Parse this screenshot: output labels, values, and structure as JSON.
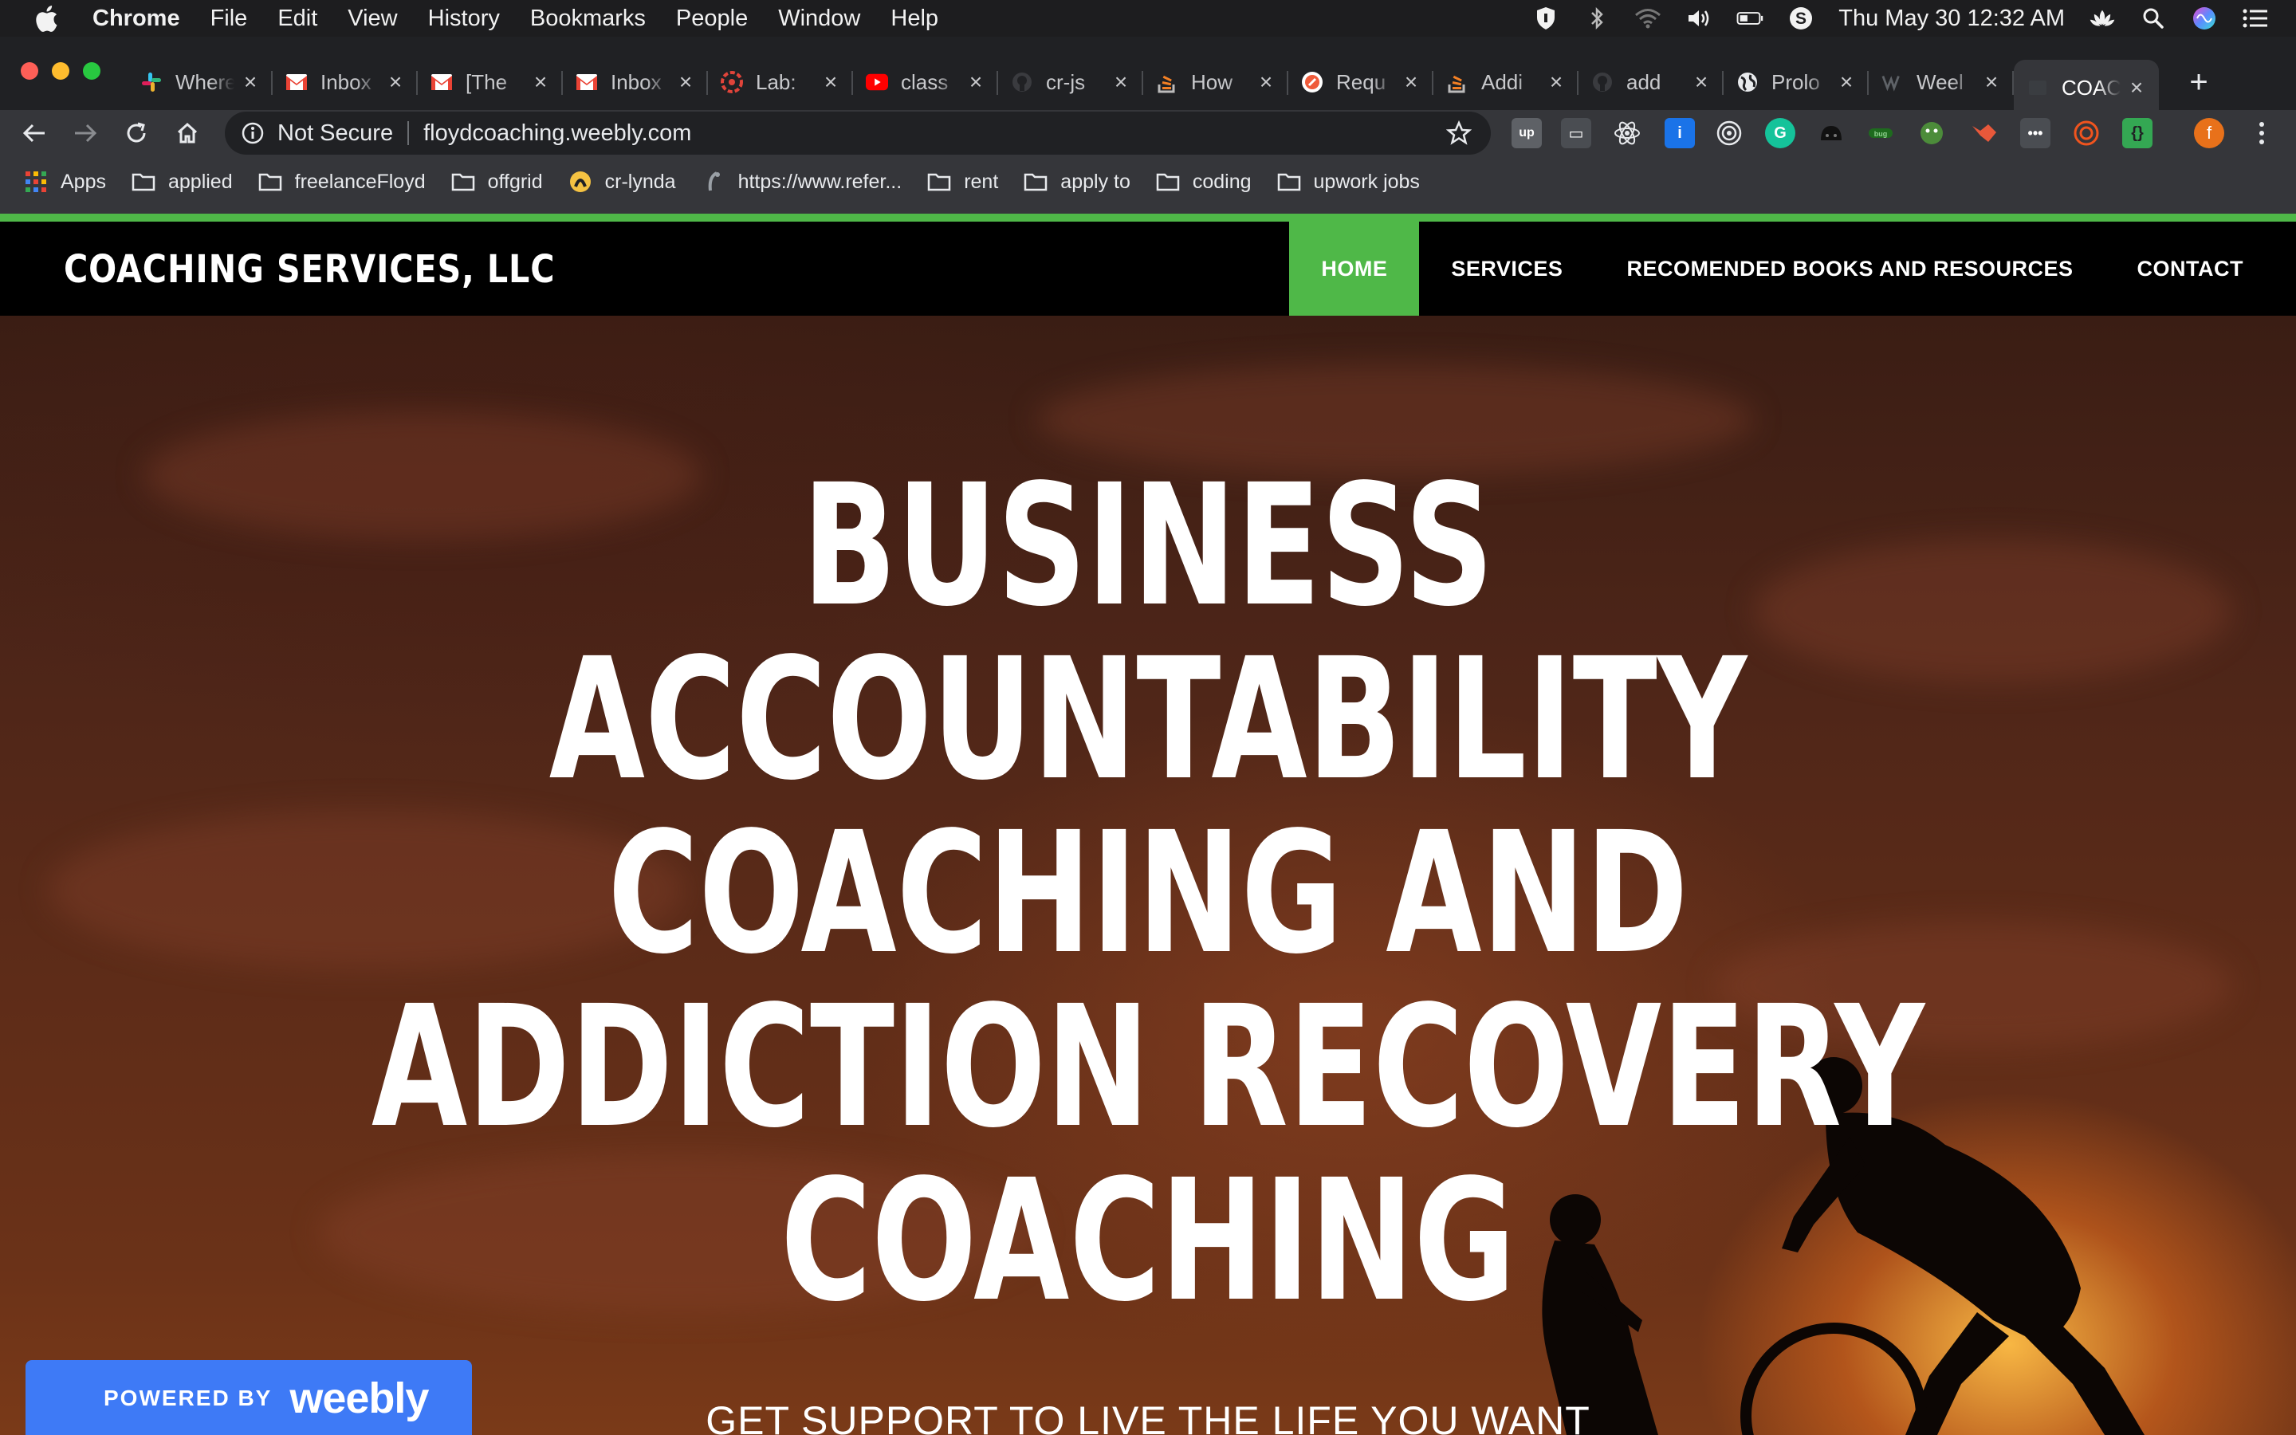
{
  "menubar": {
    "app": "Chrome",
    "items": [
      "File",
      "Edit",
      "View",
      "History",
      "Bookmarks",
      "People",
      "Window",
      "Help"
    ],
    "clock": "Thu May 30  12:32 AM"
  },
  "tabs": [
    {
      "label": "Where",
      "icon": "slack-icon"
    },
    {
      "label": "Inbox",
      "icon": "gmail-icon"
    },
    {
      "label": "[The",
      "icon": "gmail-icon"
    },
    {
      "label": "Inbox",
      "icon": "gmail-icon"
    },
    {
      "label": "Lab:",
      "icon": "lab-icon"
    },
    {
      "label": "class",
      "icon": "youtube-icon"
    },
    {
      "label": "cr-js",
      "icon": "github-icon"
    },
    {
      "label": "How",
      "icon": "stackoverflow-icon"
    },
    {
      "label": "Requ",
      "icon": "request-icon"
    },
    {
      "label": "Addi",
      "icon": "stackoverflow-icon"
    },
    {
      "label": "add",
      "icon": "github-icon"
    },
    {
      "label": "Prolo",
      "icon": "globe-icon"
    },
    {
      "label": "Weel",
      "icon": "weebly-icon"
    },
    {
      "label": "COAC",
      "icon": "page-icon",
      "active": true
    }
  ],
  "toolbar": {
    "security": "Not Secure",
    "url": "floydcoaching.weebly.com",
    "profile_initial": "f"
  },
  "bookmarks": [
    {
      "label": "Apps",
      "icon": "apps-grid-icon"
    },
    {
      "label": "applied",
      "icon": "folder-icon"
    },
    {
      "label": "freelanceFloyd",
      "icon": "folder-icon"
    },
    {
      "label": "offgrid",
      "icon": "folder-icon"
    },
    {
      "label": "cr-lynda",
      "icon": "lynda-icon"
    },
    {
      "label": "https://www.refer...",
      "icon": "link-icon"
    },
    {
      "label": "rent",
      "icon": "folder-icon"
    },
    {
      "label": "apply to",
      "icon": "folder-icon"
    },
    {
      "label": "coding",
      "icon": "folder-icon"
    },
    {
      "label": "upwork jobs",
      "icon": "folder-icon"
    }
  ],
  "site": {
    "title": "COACHING SERVICES, LLC",
    "nav": [
      "HOME",
      "SERVICES",
      "RECOMENDED BOOKS AND RESOURCES",
      "CONTACT"
    ],
    "hero_lines": [
      "BUSINESS",
      "ACCOUNTABILITY",
      "COACHING AND",
      "ADDICTION RECOVERY",
      "COACHING"
    ],
    "hero_sub": "GET SUPPORT TO LIVE THE LIFE YOU WANT",
    "badge_prefix": "POWERED BY",
    "badge_brand": "weebly",
    "accent": "#4fb848"
  }
}
